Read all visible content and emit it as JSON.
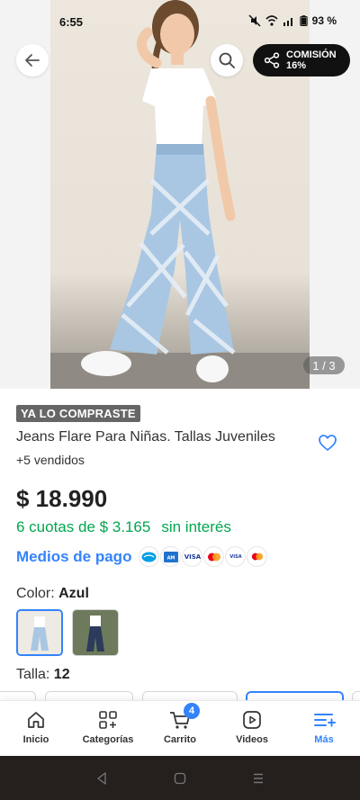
{
  "status_bar": {
    "time": "6:55",
    "battery": "93 %"
  },
  "hero": {
    "image_counter": "1 / 3",
    "commission_label": "COMISIÓN",
    "commission_value": "16%"
  },
  "product": {
    "badge": "YA LO COMPRASTE",
    "title": "Jeans Flare Para Niñas. Tallas Juveniles",
    "sold": "+5 vendidos",
    "price": "$ 18.990",
    "installments_text": "6 cuotas de $ 3.165",
    "installments_suffix": "sin interés",
    "payment_link": "Medios de pago",
    "payment_methods": [
      "mercadopago",
      "amex",
      "VISA",
      "mastercard",
      "VISA",
      "mastercard"
    ],
    "color_label": "Color: ",
    "color_value": "Azul",
    "size_label": "Talla: ",
    "size_value": "12"
  },
  "bottom_nav": [
    {
      "label": "Inicio",
      "icon": "home-icon"
    },
    {
      "label": "Categorías",
      "icon": "categories-icon"
    },
    {
      "label": "Carrito",
      "icon": "cart-icon",
      "badge": "4"
    },
    {
      "label": "Videos",
      "icon": "video-icon"
    },
    {
      "label": "Más",
      "icon": "menu-plus-icon",
      "active": true
    }
  ],
  "colors": {
    "accent": "#3483fa",
    "green": "#00a650",
    "badge_bg": "#666666",
    "nav_bar": "#251f1d"
  }
}
